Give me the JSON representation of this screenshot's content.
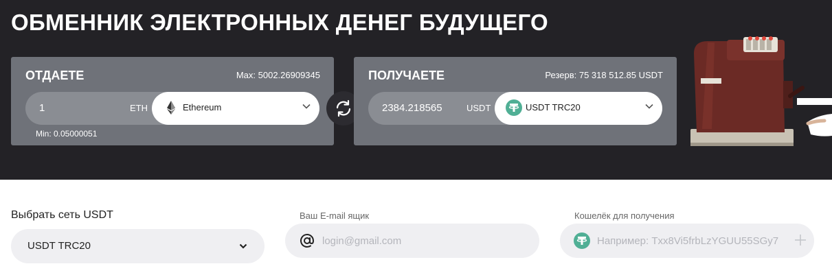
{
  "hero": {
    "title": "ОБМЕННИК ЭЛЕКТРОННЫХ ДЕНЕГ БУДУЩЕГО"
  },
  "give": {
    "title": "ОТДАЕТЕ",
    "max_label": "Max: 5002.26909345",
    "amount": "1",
    "unit": "ETH",
    "currency": "Ethereum",
    "currency_icon": "ethereum-icon",
    "min_label": "Min: 0.05000051"
  },
  "swap": {
    "icon": "swap-arrows-icon"
  },
  "get": {
    "title": "ПОЛУЧАЕТЕ",
    "reserve_label": "Резерв: 75 318 512.85 USDT",
    "amount": "2384.218565",
    "unit": "USDT",
    "currency": "USDT TRC20",
    "currency_icon": "tether-icon"
  },
  "form": {
    "network_label": "Выбрать сеть USDT",
    "network_value": "USDT TRC20",
    "email_label": "Ваш E-mail ящик",
    "email_placeholder": "login@gmail.com",
    "wallet_label": "Кошелёк для получения",
    "wallet_placeholder": "Например: Txx8Vi5frbLzYGUU55SGy7"
  },
  "colors": {
    "hero_bg": "#232226",
    "panel_bg": "#6f7279",
    "tether_green": "#50af95",
    "field_bg": "#efeff2"
  }
}
